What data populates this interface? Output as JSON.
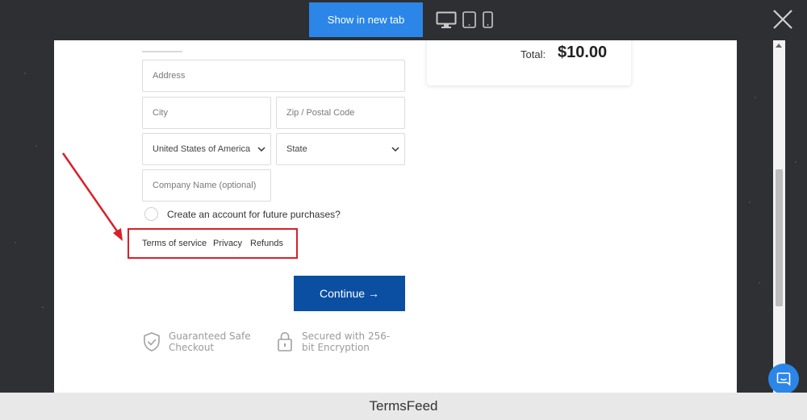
{
  "toolbar": {
    "show_in_new_tab": "Show in new tab",
    "devices": [
      "desktop-icon",
      "tablet-icon",
      "mobile-icon"
    ],
    "accent": "#2b86e8"
  },
  "form": {
    "address_placeholder": "Address",
    "city_placeholder": "City",
    "zip_placeholder": "Zip / Postal Code",
    "country_selected": "United States of America",
    "state_selected": "State",
    "company_placeholder": "Company Name (optional)",
    "create_account_label": "Create an account for future purchases?"
  },
  "policy_links": {
    "terms": "Terms of service",
    "privacy": "Privacy",
    "refunds": "Refunds",
    "highlight_color": "#d9202a"
  },
  "continue_button": {
    "label": "Continue →",
    "color": "#0b4fa3"
  },
  "badges": {
    "safe_line1": "Guaranteed Safe",
    "safe_line2": "Checkout",
    "secure_line1": "Secured with 256-",
    "secure_line2": "bit Encryption"
  },
  "summary": {
    "total_label": "Total:",
    "total_value": "$10.00"
  },
  "footer": {
    "text": "TermsFeed"
  }
}
